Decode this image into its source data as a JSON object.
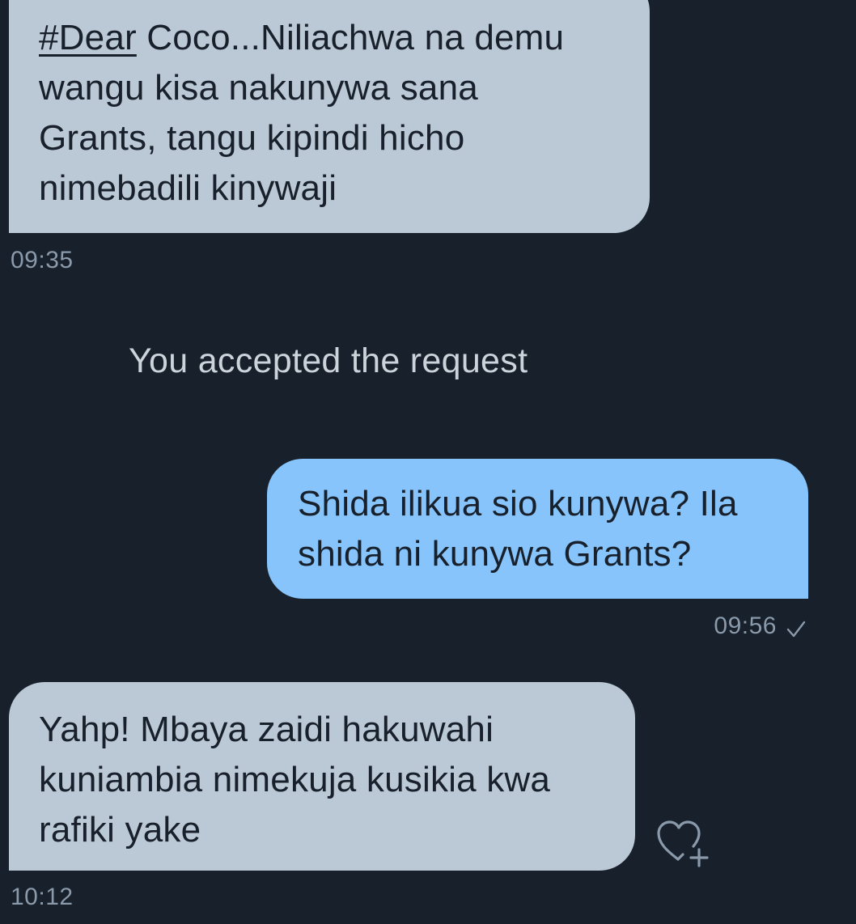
{
  "messages": [
    {
      "direction": "received",
      "hashtag": "#Dear",
      "lines": [
        " Coco...Niliachwa na demu",
        "wangu kisa nakunywa sana",
        "Grants, tangu kipindi hicho",
        "nimebadili kinywaji"
      ],
      "time": "09:35"
    },
    {
      "direction": "system",
      "text": "You accepted the request"
    },
    {
      "direction": "sent",
      "lines": [
        "Shida ilikua sio kunywa? Ila",
        "shida ni kunywa Grants?"
      ],
      "time": "09:56",
      "status_icon": "check-icon"
    },
    {
      "direction": "received",
      "lines": [
        "Yahp! Mbaya zaidi hakuwahi",
        "kuniambia nimekuja kusikia kwa",
        "rafiki yake"
      ],
      "time": "10:12",
      "action_icon": "heart-plus-icon"
    }
  ],
  "colors": {
    "background": "#18202b",
    "received_bubble": "#bbc8d5",
    "sent_bubble": "#86c4fb",
    "timestamp": "#8a9aab",
    "system_text": "#ccd3db"
  }
}
